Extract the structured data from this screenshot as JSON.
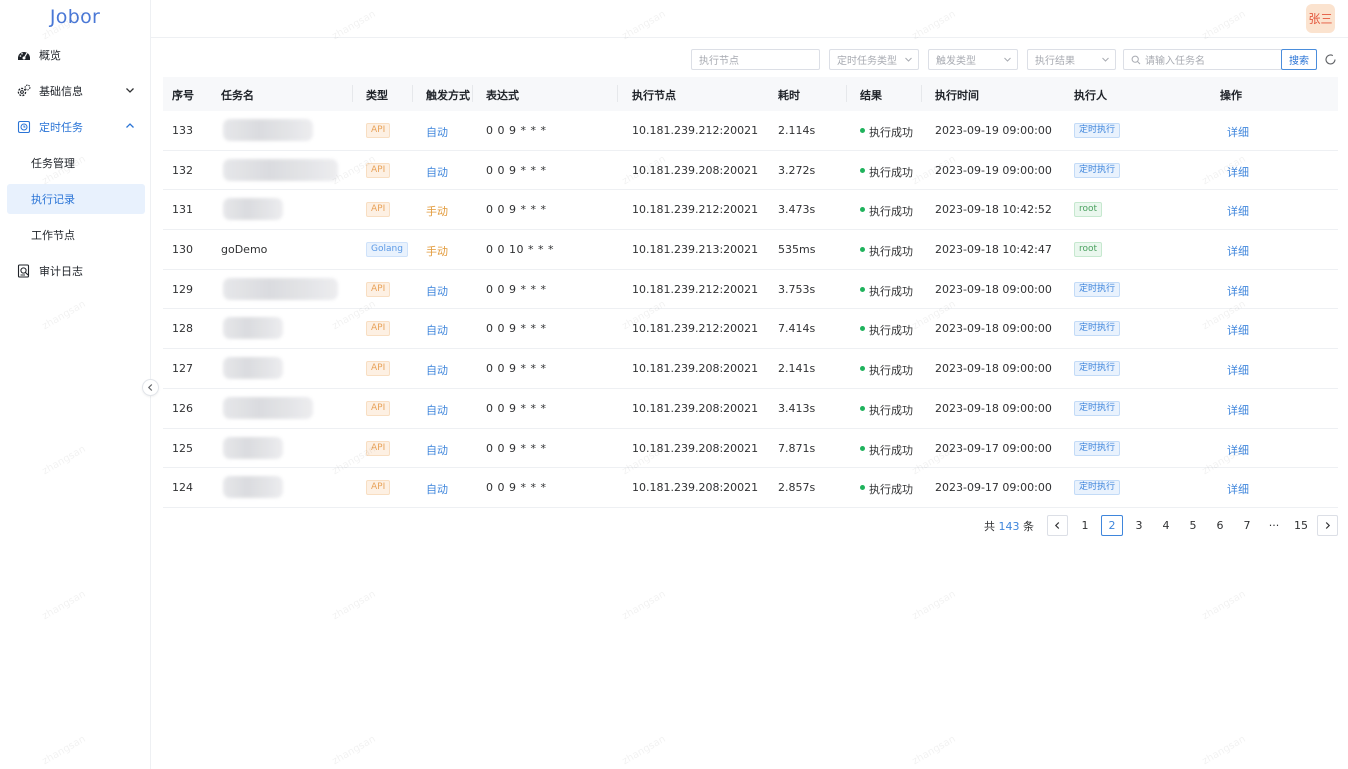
{
  "app": {
    "logo": "Jobor",
    "user_avatar": "张三",
    "watermark": "zhangsan"
  },
  "sidebar": {
    "items": [
      {
        "label": "概览",
        "icon": "dashboard-icon"
      },
      {
        "label": "基础信息",
        "icon": "gears-icon",
        "expanded": false
      },
      {
        "label": "定时任务",
        "icon": "schedule-icon",
        "expanded": true
      },
      {
        "label": "任务管理"
      },
      {
        "label": "执行记录",
        "active": true
      },
      {
        "label": "工作节点"
      },
      {
        "label": "审计日志",
        "icon": "audit-log-icon"
      }
    ]
  },
  "filters": {
    "node_placeholder": "执行节点",
    "task_type_placeholder": "定时任务类型",
    "trigger_placeholder": "触发类型",
    "result_placeholder": "执行结果",
    "search_placeholder": "请输入任务名",
    "search_label": "搜索"
  },
  "table": {
    "headers": [
      "序号",
      "任务名",
      "类型",
      "触发方式",
      "表达式",
      "执行节点",
      "耗时",
      "结果",
      "执行时间",
      "执行人",
      "操作"
    ],
    "rows": [
      {
        "id": "133",
        "name": "",
        "type": "API",
        "trigger": "自动",
        "expr": "0 0 9 * * *",
        "node": "10.181.239.212:20021",
        "duration": "2.114s",
        "result": "执行成功",
        "time": "2023-09-19 09:00:00",
        "executor": "定时执行",
        "action": "详细"
      },
      {
        "id": "132",
        "name": "",
        "type": "API",
        "trigger": "自动",
        "expr": "0 0 9 * * *",
        "node": "10.181.239.208:20021",
        "duration": "3.272s",
        "result": "执行成功",
        "time": "2023-09-19 09:00:00",
        "executor": "定时执行",
        "action": "详细"
      },
      {
        "id": "131",
        "name": "",
        "type": "API",
        "trigger": "手动",
        "expr": "0 0 9 * * *",
        "node": "10.181.239.212:20021",
        "duration": "3.473s",
        "result": "执行成功",
        "time": "2023-09-18 10:42:52",
        "executor": "root",
        "action": "详细"
      },
      {
        "id": "130",
        "name": "goDemo",
        "type": "Golang",
        "trigger": "手动",
        "expr": "0 0 10 * * *",
        "node": "10.181.239.213:20021",
        "duration": "535ms",
        "result": "执行成功",
        "time": "2023-09-18 10:42:47",
        "executor": "root",
        "action": "详细"
      },
      {
        "id": "129",
        "name": "",
        "type": "API",
        "trigger": "自动",
        "expr": "0 0 9 * * *",
        "node": "10.181.239.212:20021",
        "duration": "3.753s",
        "result": "执行成功",
        "time": "2023-09-18 09:00:00",
        "executor": "定时执行",
        "action": "详细"
      },
      {
        "id": "128",
        "name": "",
        "type": "API",
        "trigger": "自动",
        "expr": "0 0 9 * * *",
        "node": "10.181.239.212:20021",
        "duration": "7.414s",
        "result": "执行成功",
        "time": "2023-09-18 09:00:00",
        "executor": "定时执行",
        "action": "详细"
      },
      {
        "id": "127",
        "name": "",
        "type": "API",
        "trigger": "自动",
        "expr": "0 0 9 * * *",
        "node": "10.181.239.208:20021",
        "duration": "2.141s",
        "result": "执行成功",
        "time": "2023-09-18 09:00:00",
        "executor": "定时执行",
        "action": "详细"
      },
      {
        "id": "126",
        "name": "",
        "type": "API",
        "trigger": "自动",
        "expr": "0 0 9 * * *",
        "node": "10.181.239.208:20021",
        "duration": "3.413s",
        "result": "执行成功",
        "time": "2023-09-18 09:00:00",
        "executor": "定时执行",
        "action": "详细"
      },
      {
        "id": "125",
        "name": "",
        "type": "API",
        "trigger": "自动",
        "expr": "0 0 9 * * *",
        "node": "10.181.239.208:20021",
        "duration": "7.871s",
        "result": "执行成功",
        "time": "2023-09-17 09:00:00",
        "executor": "定时执行",
        "action": "详细"
      },
      {
        "id": "124",
        "name": "",
        "type": "API",
        "trigger": "自动",
        "expr": "0 0 9 * * *",
        "node": "10.181.239.208:20021",
        "duration": "2.857s",
        "result": "执行成功",
        "time": "2023-09-17 09:00:00",
        "executor": "定时执行",
        "action": "详细"
      }
    ]
  },
  "pagination": {
    "total_prefix": "共",
    "total": "143",
    "total_suffix": "条",
    "pages": [
      "1",
      "2",
      "3",
      "4",
      "5",
      "6",
      "7",
      "···",
      "15"
    ],
    "current": "2"
  },
  "colors": {
    "accent": "#3f86dc",
    "success": "#1fb25c",
    "warning": "#e29a3b"
  }
}
